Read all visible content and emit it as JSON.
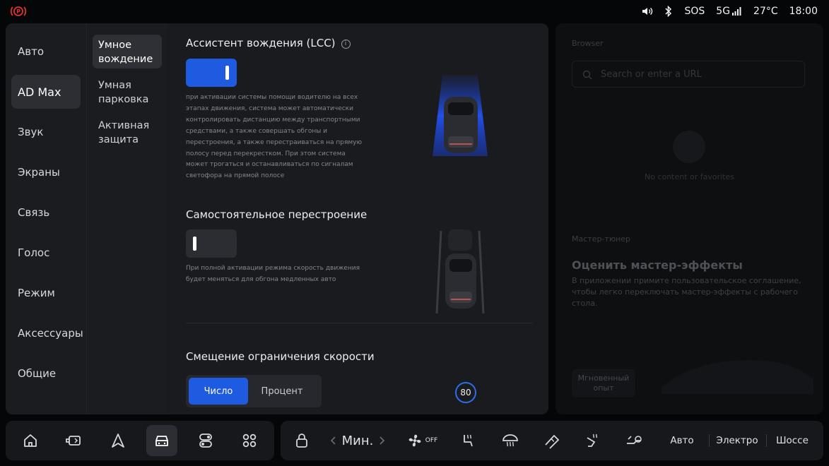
{
  "status": {
    "icons": [
      "brake-warning-icon",
      "volume-icon",
      "bluetooth-icon",
      "signal-icon"
    ],
    "sos": "SOS",
    "network": "5G",
    "temperature": "27°C",
    "time": "18:00"
  },
  "left_nav": {
    "items": [
      {
        "label": "Авто",
        "active": false
      },
      {
        "label": "AD Max",
        "active": true
      },
      {
        "label": "Звук",
        "active": false
      },
      {
        "label": "Экраны",
        "active": false
      },
      {
        "label": "Связь",
        "active": false
      },
      {
        "label": "Голос",
        "active": false
      },
      {
        "label": "Режим",
        "active": false
      },
      {
        "label": "Аксессуары",
        "active": false
      },
      {
        "label": "Общие",
        "active": false
      }
    ]
  },
  "sub_nav": {
    "items": [
      {
        "label": "Умное вождение",
        "active": true
      },
      {
        "label": "Умная парковка",
        "active": false
      },
      {
        "label": "Активная защита",
        "active": false
      }
    ]
  },
  "lcc": {
    "title": "Ассистент вождения (LCC)",
    "info_glyph": "i",
    "enabled": true,
    "description": "при активации системы помощи водителю на всех этапах движения, система может автоматически контролировать дистанцию между транспортными средствами, а также совершать обгоны и перестроения, а также перестраиваться на прямую полосу перед перекрестком. При этом система может трогаться и останавливаться по сигналам светофора на прямой полосе"
  },
  "lane_change": {
    "title": "Самостоятельное перестроение",
    "enabled": false,
    "description": "При полной активации режима скорость движения будет меняться для обгона медленных авто"
  },
  "speed_offset": {
    "title": "Смещение ограничения скорости",
    "options": [
      "Число",
      "Процент"
    ],
    "selected": "Число",
    "speed_sign": "80"
  },
  "browser": {
    "label": "Browser",
    "search_placeholder": "Search or enter a URL",
    "empty_text": "No content or favorites"
  },
  "tuner": {
    "label": "Мастер-тюнер",
    "title": "Оценить мастер-эффекты",
    "subtitle": "В приложении примите пользовательское соглашение, чтобы легко переключать мастер-эффекты с рабочего стола.",
    "button": "Мгновенный опыт"
  },
  "dock": {
    "apps": [
      "home-icon",
      "side-mirror-icon",
      "navigation-icon",
      "car-icon",
      "switches-icon",
      "grid-icon"
    ],
    "active_app": "car-icon",
    "fan_level": "Мин.",
    "fan_off_label": "OFF",
    "drive_modes": [
      "Авто",
      "Электро",
      "Шоссе"
    ]
  }
}
